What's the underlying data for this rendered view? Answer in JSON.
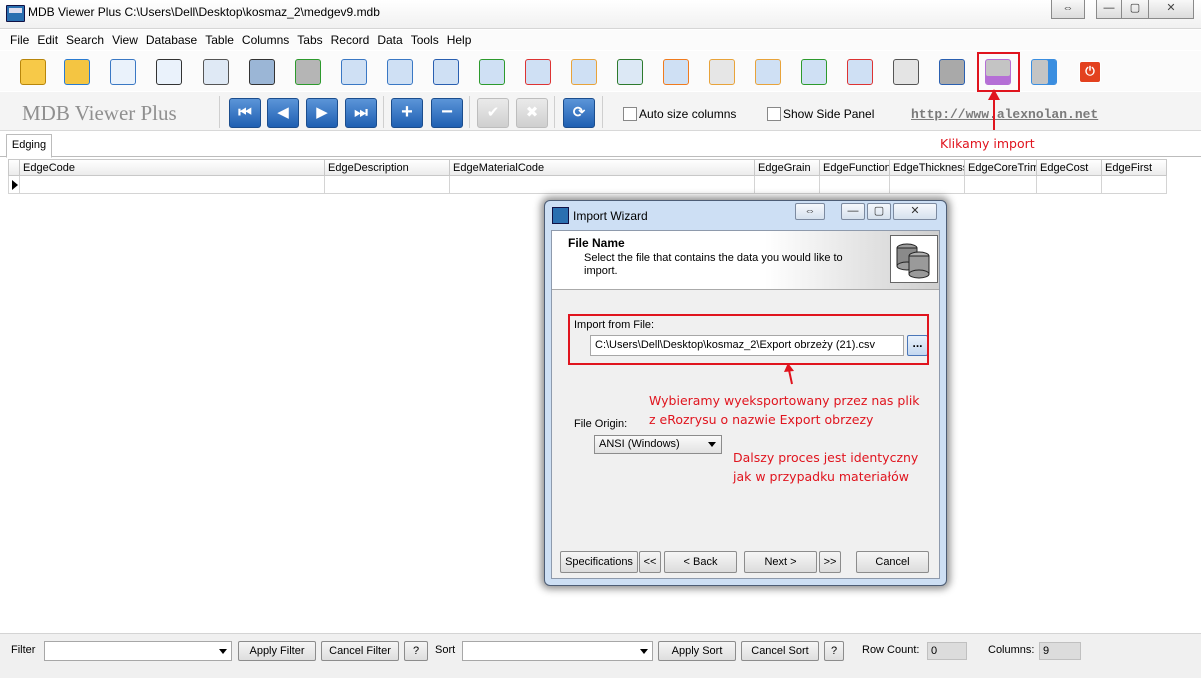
{
  "window": {
    "title": "MDB Viewer Plus C:\\Users\\Dell\\Desktop\\kosmaz_2\\medgev9.mdb"
  },
  "menu": [
    "File",
    "Edit",
    "Search",
    "View",
    "Database",
    "Table",
    "Columns",
    "Tabs",
    "Record",
    "Data",
    "Tools",
    "Help"
  ],
  "toolbar": {
    "icons": [
      "open-folder-icon",
      "open-recent-icon",
      "table-view-icon",
      "search-icon",
      "query-icon",
      "sql-icon",
      "database-add-icon",
      "tables-icon",
      "columns-icon",
      "table-info-icon",
      "add-row-icon",
      "delete-row-icon",
      "edit-table-icon",
      "replace-ab-icon",
      "refresh-table-icon",
      "settings-icon",
      "link-icon",
      "add-link-icon",
      "remove-link-icon",
      "print-icon",
      "database-stack-icon",
      "import-icon",
      "export-icon",
      "power-icon"
    ]
  },
  "toolbar2": {
    "brand": "MDB Viewer Plus",
    "auto_size": "Auto size columns",
    "side_panel": "Show Side Panel",
    "site": "http://www.alexnolan.net"
  },
  "tabs": [
    "Edging"
  ],
  "grid": {
    "columns": [
      "EdgeCode",
      "EdgeDescription",
      "EdgeMaterialCode",
      "EdgeGrain",
      "EdgeFunction",
      "EdgeThickness",
      "EdgeCoreTrim",
      "EdgeCost",
      "EdgeFirst"
    ]
  },
  "dialog": {
    "title": "Import Wizard",
    "heading": "File Name",
    "description": "Select the file that contains the data you would like to import.",
    "import_label": "Import from File:",
    "file_path": "C:\\Users\\Dell\\Desktop\\kosmaz_2\\Export obrzeży (21).csv",
    "browse": "...",
    "origin_label": "File Origin:",
    "origin_value": "ANSI (Windows)",
    "buttons": {
      "specs": "Specifications",
      "first": "<<",
      "back": "< Back",
      "next": "Next >",
      "last": ">>",
      "cancel": "Cancel"
    }
  },
  "annotations": {
    "import_note": "Klikamy import",
    "file_note_1": "Wybieramy wyeksportowany przez nas plik",
    "file_note_2": "z eRozrysu o nazwie Export obrzezy",
    "process_note_1": "Dalszy proces jest identyczny",
    "process_note_2": "jak w przypadku materiałów"
  },
  "bottom": {
    "filter_label": "Filter",
    "apply_filter": "Apply Filter",
    "cancel_filter": "Cancel Filter",
    "help": "?",
    "sort_label": "Sort",
    "apply_sort": "Apply Sort",
    "cancel_sort": "Cancel Sort",
    "row_count_label": "Row Count:",
    "row_count": "0",
    "columns_label": "Columns:",
    "columns": "9"
  },
  "colors": {
    "accent_blue": "#1f5fb2",
    "annotation_red": "#e0141e"
  }
}
